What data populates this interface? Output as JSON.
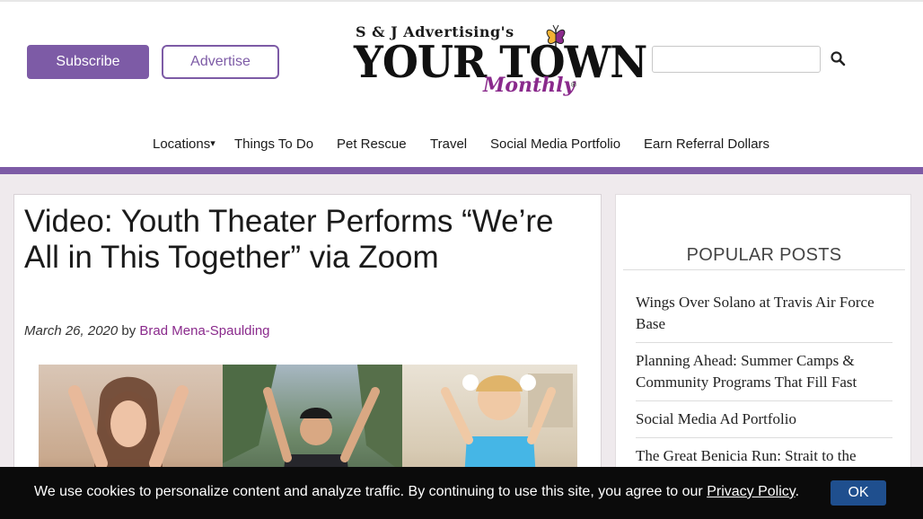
{
  "header": {
    "subscribe_label": "Subscribe",
    "advertise_label": "Advertise",
    "logo": {
      "tagline": "S & J Advertising's",
      "title": "YOUR TOWN",
      "subtitle": "Monthly",
      "registered": "®"
    },
    "search": {
      "value": "",
      "placeholder": ""
    }
  },
  "nav": {
    "items": [
      {
        "label": "Locations",
        "has_dropdown": true,
        "caret": "▾"
      },
      {
        "label": "Things To Do"
      },
      {
        "label": "Pet Rescue"
      },
      {
        "label": "Travel"
      },
      {
        "label": "Social Media Portfolio"
      },
      {
        "label": "Earn Referral Dollars"
      }
    ]
  },
  "article": {
    "title": "Video: Youth Theater Performs “We’re All in This Together” via Zoom",
    "date": "March 26, 2020",
    "by": "by",
    "author": "Brad Mena-Spaulding"
  },
  "sidebar": {
    "heading": "POPULAR POSTS",
    "posts": [
      "Wings Over Solano at Travis Air Force Base",
      "Planning Ahead: Summer Camps & Community Programs That Fill Fast",
      "Social Media Ad Portfolio",
      "The Great Benicia Run: Strait to the"
    ]
  },
  "cookie": {
    "text": "We use cookies to personalize content and analyze traffic. By continuing to use this site, you agree to our",
    "link_label": "Privacy Policy",
    "period": ".",
    "ok_label": "OK"
  },
  "colors": {
    "brand_purple": "#7d5ba6",
    "author_magenta": "#8a2a8c",
    "cookie_button": "#1f4f8e",
    "page_background": "#efeaed"
  },
  "icons": {
    "search": "search-icon",
    "logo_decoration": "butterfly-icon",
    "dropdown": "caret-down-icon"
  }
}
